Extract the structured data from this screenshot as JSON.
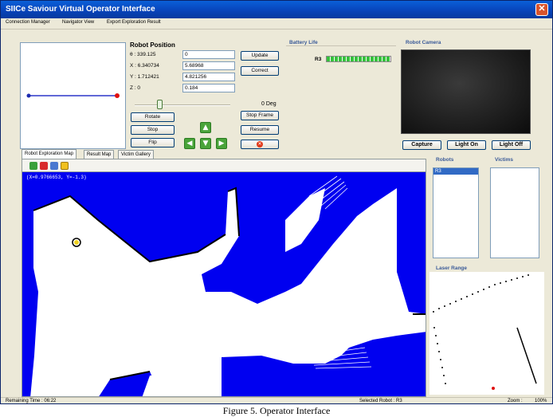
{
  "window": {
    "title": "SIICe Saviour Virtual Operator Interface"
  },
  "menu": [
    "Connection Manager",
    "Navigator View",
    "Export Exploration Result"
  ],
  "robot_position": {
    "title": "Robot Position",
    "theta_label": "θ : 339.125",
    "x_label": "X : 6.340734",
    "y_label": "Y : 1.712421",
    "z_label": "Z : 0",
    "theta_input": "0",
    "x_input": "5.68968",
    "y_input": "4.821256",
    "z_input": "0.184",
    "slider_readout": "0 Deg",
    "slider_level": 0.25
  },
  "buttons": {
    "update": "Update",
    "correct": "Correct",
    "rotate": "Rotate",
    "stop": "Stop",
    "flip": "Flip",
    "stop_frame": "Stop Frame",
    "resume": "Resume",
    "capture": "Capture",
    "light_on": "Light On",
    "light_off": "Light Off"
  },
  "battery": {
    "title": "Battery Life",
    "robot": "R3",
    "level": 1.0,
    "color": "#36c23c"
  },
  "camera": {
    "title": "Robot Camera"
  },
  "tabs": [
    "Robot Exploration Map",
    "Result Map",
    "Victim Gallery"
  ],
  "map": {
    "coords": "(X=0.9766653, Y=-1.3)",
    "background": "#0000f0"
  },
  "robots": {
    "title": "Robots",
    "items": [
      "R3"
    ]
  },
  "victims": {
    "title": "Victims"
  },
  "laser": {
    "title": "Laser Range"
  },
  "status": {
    "remaining": "Remaining Time :  06:22",
    "selected": "Selected Robot :  R3",
    "zoom": "Zoom :",
    "zoom_value": "100%"
  },
  "caption": "Figure 5. Operator Interface"
}
